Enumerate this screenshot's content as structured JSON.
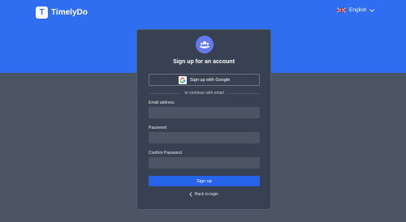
{
  "brand": {
    "name": "TimelyDo",
    "initial": "T"
  },
  "language": {
    "label": "English",
    "flag": "uk-flag-icon"
  },
  "signup": {
    "title": "Sign up for an account",
    "google_label": "Sign up with Google",
    "divider_text": "or continue with email",
    "email_label": "Email address",
    "email_value": "",
    "password_label": "Password",
    "password_value": "",
    "confirm_label": "Confirm Password",
    "confirm_value": "",
    "submit_label": "Sign up",
    "back_label": "Back to login"
  },
  "colors": {
    "header_blue": "#2f6ef0",
    "page_gray": "#4b5563",
    "card": "#374151",
    "accent": "#2563eb",
    "avatar": "#6478f0"
  }
}
